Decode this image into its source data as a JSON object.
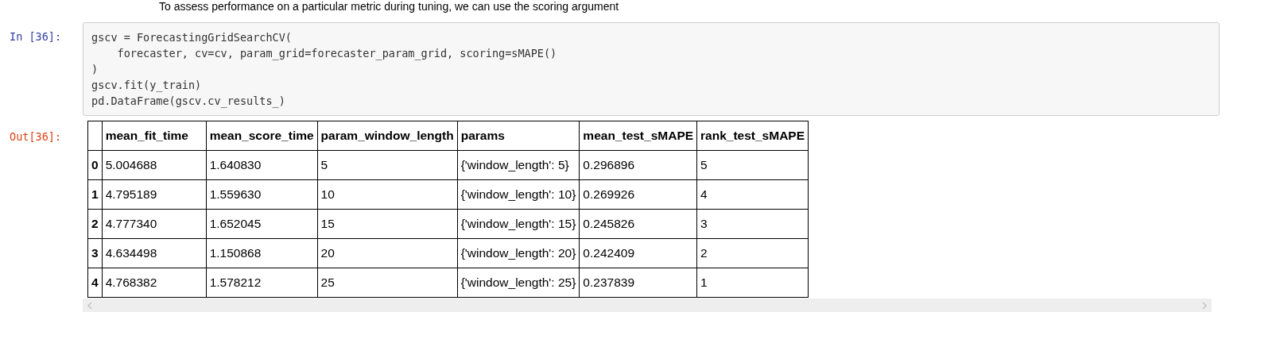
{
  "text_cell": {
    "text": "To assess performance on a particular metric during tuning, we can use the scoring argument"
  },
  "input_cell": {
    "prompt": "In [36]:",
    "code": [
      "gscv = ForecastingGridSearchCV(",
      "    forecaster, cv=cv, param_grid=forecaster_param_grid, scoring=sMAPE()",
      ")",
      "gscv.fit(y_train)",
      "pd.DataFrame(gscv.cv_results_)"
    ]
  },
  "output_cell": {
    "prompt": "Out[36]:",
    "table": {
      "columns": [
        "mean_fit_time",
        "mean_score_time",
        "param_window_length",
        "params",
        "mean_test_sMAPE",
        "rank_test_sMAPE"
      ],
      "rows": [
        {
          "index": "0",
          "cells": [
            "5.004688",
            "1.640830",
            "5",
            "{'window_length': 5}",
            "0.296896",
            "5"
          ]
        },
        {
          "index": "1",
          "cells": [
            "4.795189",
            "1.559630",
            "10",
            "{'window_length': 10}",
            "0.269926",
            "4"
          ]
        },
        {
          "index": "2",
          "cells": [
            "4.777340",
            "1.652045",
            "15",
            "{'window_length': 15}",
            "0.245826",
            "3"
          ]
        },
        {
          "index": "3",
          "cells": [
            "4.634498",
            "1.150868",
            "20",
            "{'window_length': 20}",
            "0.242409",
            "2"
          ]
        },
        {
          "index": "4",
          "cells": [
            "4.768382",
            "1.578212",
            "25",
            "{'window_length': 25}",
            "0.237839",
            "1"
          ]
        }
      ]
    }
  }
}
